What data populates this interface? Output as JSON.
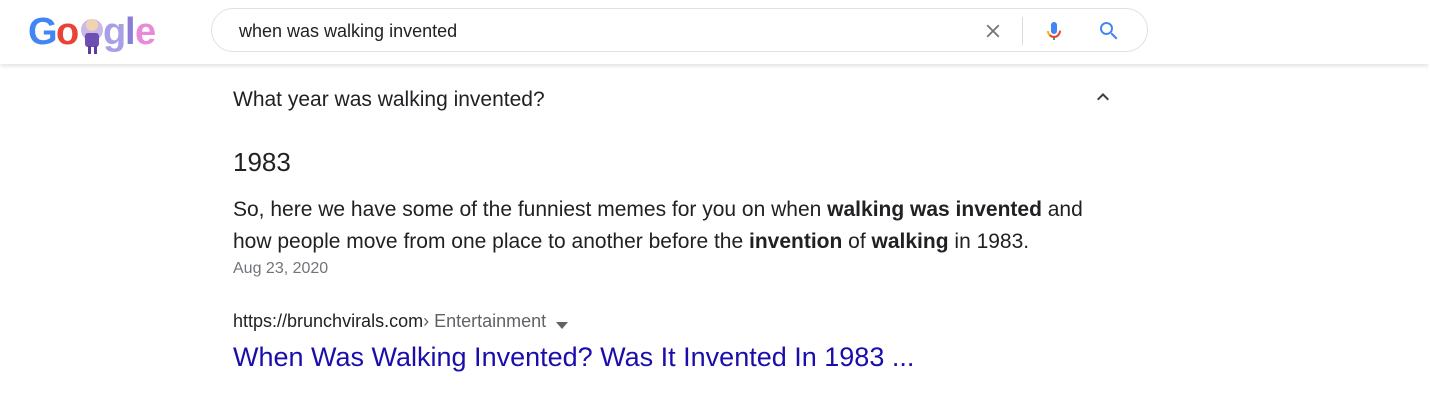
{
  "search": {
    "query": "when was walking invented"
  },
  "faq": {
    "question": "What year was walking invented?",
    "answer": "1983",
    "snippet": {
      "part1": "So, here we have some of the funniest memes for you on when ",
      "bold1": "walking was invented",
      "part2": " and how people move from one place to another before the ",
      "bold2": "invention",
      "part3": " of ",
      "bold3": "walking",
      "part4": " in 1983."
    },
    "date": "Aug 23, 2020",
    "source": {
      "url": "https://brunchvirals.com",
      "path": " › Entertainment"
    },
    "result_title": "When Was Walking Invented? Was It Invented In 1983 ..."
  },
  "icons": {
    "clear": "close-icon",
    "mic": "microphone-icon",
    "search": "search-icon",
    "collapse": "chevron-up-icon",
    "menu": "caret-down-icon"
  },
  "colors": {
    "link": "#1a0dab",
    "text": "#202124",
    "secondary": "#70757a",
    "search_blue": "#4285f4"
  }
}
